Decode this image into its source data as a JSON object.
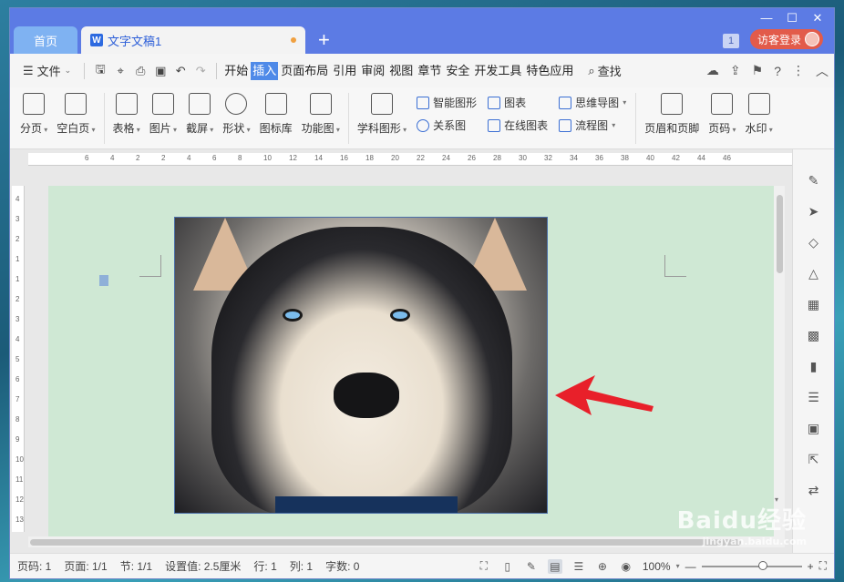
{
  "titlebar": {
    "home_tab": "首页",
    "doc_tab": "文字文稿1",
    "doc_icon": "W",
    "new_tab": "+",
    "window_count": "1",
    "login": "访客登录"
  },
  "menubar": {
    "file": "文件",
    "items": [
      "开始",
      "插入",
      "页面布局",
      "引用",
      "审阅",
      "视图",
      "章节",
      "安全",
      "开发工具",
      "特色应用"
    ],
    "active_index": 1,
    "search": "查找"
  },
  "ribbon": {
    "large": [
      {
        "label": "分页",
        "icon": "page-break-icon"
      },
      {
        "label": "空白页",
        "icon": "blank-page-icon"
      },
      {
        "label": "表格",
        "icon": "table-icon"
      },
      {
        "label": "图片",
        "icon": "picture-icon"
      },
      {
        "label": "截屏",
        "icon": "screenshot-icon"
      },
      {
        "label": "形状",
        "icon": "shape-icon"
      },
      {
        "label": "图标库",
        "icon": "icon-library-icon"
      },
      {
        "label": "功能图",
        "icon": "function-chart-icon"
      },
      {
        "label": "学科图形",
        "icon": "subject-graphics-icon"
      }
    ],
    "small_col1": [
      "智能图形",
      "关系图"
    ],
    "small_col2": [
      "图表",
      "在线图表"
    ],
    "small_col3": [
      "思维导图",
      "流程图"
    ],
    "large_right": [
      {
        "label": "页眉和页脚",
        "icon": "header-footer-icon"
      },
      {
        "label": "页码",
        "icon": "page-number-icon"
      },
      {
        "label": "水印",
        "icon": "watermark-icon"
      }
    ]
  },
  "ruler": {
    "h_ticks": [
      "6",
      "4",
      "2",
      "2",
      "4",
      "6",
      "8",
      "10",
      "12",
      "14",
      "16",
      "18",
      "20",
      "22",
      "24",
      "26",
      "28",
      "30",
      "32",
      "34",
      "36",
      "38",
      "40",
      "42",
      "44",
      "46"
    ],
    "v_ticks": [
      "4",
      "3",
      "2",
      "1",
      "1",
      "2",
      "3",
      "4",
      "5",
      "6",
      "7",
      "8",
      "9",
      "10",
      "11",
      "12",
      "13"
    ]
  },
  "statusbar": {
    "page_num": "页码: 1",
    "pages": "页面: 1/1",
    "section": "节: 1/1",
    "setting": "设置值: 2.5厘米",
    "row": "行: 1",
    "col": "列: 1",
    "words": "字数: 0",
    "zoom": "100%"
  },
  "watermark": {
    "big": "Baidu经验",
    "small": "jingyan.baidu.com"
  },
  "colors": {
    "titlebar": "#5c7be4",
    "accent": "#4f8ae8",
    "page": "#cfe8d4",
    "arrow": "#e8202a"
  }
}
